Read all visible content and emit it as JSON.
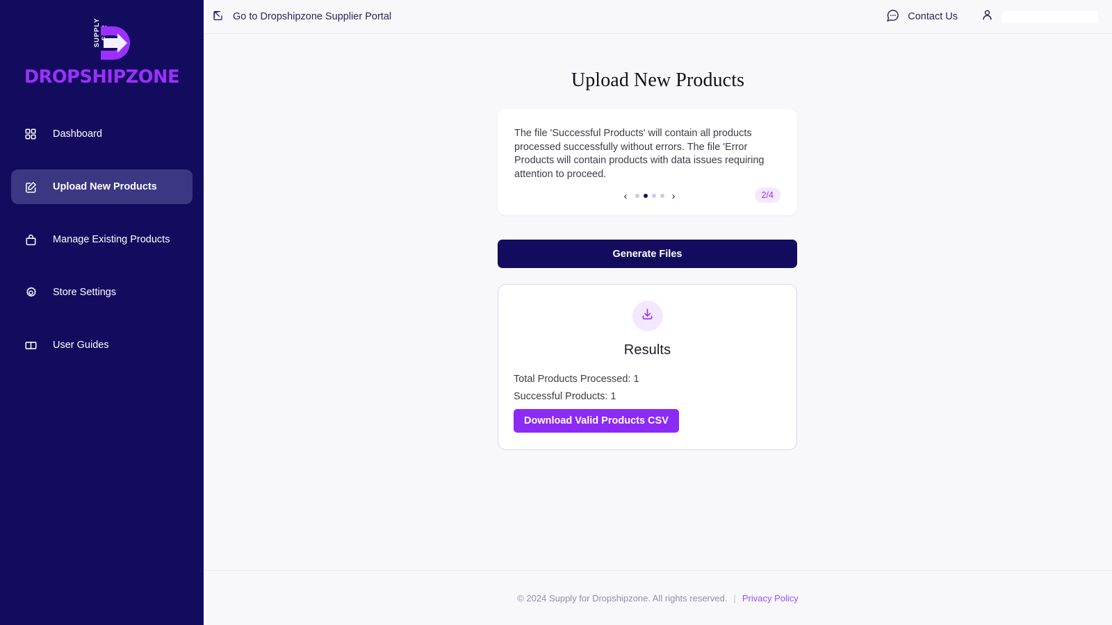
{
  "brand": {
    "supply_for": "SUPPLY FOR",
    "name": "DROPSHIPZONE",
    "logo_purple": "#9b30ff",
    "sidebar_bg": "#130c5e"
  },
  "sidebar": {
    "items": [
      {
        "label": "Dashboard",
        "icon": "grid-icon",
        "active": false
      },
      {
        "label": "Upload New Products",
        "icon": "edit-square-icon",
        "active": true
      },
      {
        "label": "Manage Existing Products",
        "icon": "archive-box-icon",
        "active": false
      },
      {
        "label": "Store Settings",
        "icon": "gear-icon",
        "active": false
      },
      {
        "label": "User Guides",
        "icon": "open-book-icon",
        "active": false
      }
    ]
  },
  "topbar": {
    "portal_link_label": "Go to Dropshipzone Supplier Portal",
    "portal_link_icon": "external-link-icon",
    "contact_label": "Contact Us",
    "contact_icon": "chat-bubble-dots-icon",
    "user_icon": "user-icon",
    "user_name": ""
  },
  "main": {
    "page_title": "Upload New Products",
    "info_card": {
      "text": "The file 'Successful Products' will contain all products processed successfully without errors. The file 'Error Products will contain products with data issues requiring attention to proceed.",
      "prev_label": "‹",
      "next_label": "›",
      "dots_total": 4,
      "dots_active_index": 1,
      "step_badge": "2/4",
      "badge_bg": "#f3e8ff",
      "badge_color": "#9333ea"
    },
    "generate_button": {
      "label": "Generate Files",
      "bg": "#130c5e",
      "color": "#ffffff"
    },
    "results": {
      "icon": "download-icon",
      "title": "Results",
      "lines": [
        "Total Products Processed: 1",
        "Successful Products: 1"
      ],
      "download_button_label": "Download Valid Products CSV",
      "download_button_bg": "#8b2bf5",
      "card_border": "#e3cffa"
    }
  },
  "footer": {
    "copyright": "© 2024 Supply for Dropshipzone. All rights reserved.",
    "separator": "|",
    "privacy_label": "Privacy Policy",
    "privacy_color": "#9b4dff"
  }
}
